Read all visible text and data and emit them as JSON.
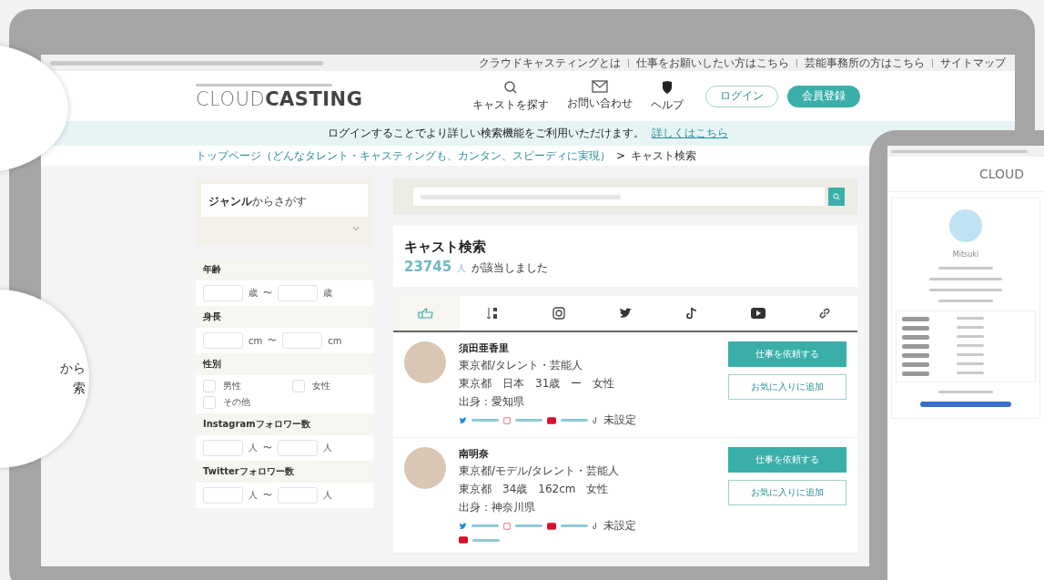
{
  "callout": {
    "lines": [
      "から",
      "索"
    ]
  },
  "laptop": {
    "top_bar": {
      "links": [
        "クラウドキャスティングとは",
        "仕事をお願いしたい方はこちら",
        "芸能事務所の方はこちら",
        "サイトマップ"
      ]
    },
    "header": {
      "logo_light": "CLOUD",
      "logo_bold": "CASTING",
      "nav": [
        {
          "kind": "search",
          "label": "キャストを探す"
        },
        {
          "kind": "mail",
          "label": "お問い合わせ"
        },
        {
          "kind": "help",
          "label": "ヘルプ"
        }
      ],
      "buttons": [
        {
          "kind": "outline",
          "label": "ログイン"
        },
        {
          "kind": "filled",
          "label": "会員登録"
        }
      ]
    },
    "notice": {
      "text": "ログインすることでより詳しい検索機能をご利用いただけます。",
      "link": "詳しくはこちら"
    },
    "breadcrumb": {
      "link": "トップページ（どんなタレント・キャスティングも、カンタン、スピーディに実現）",
      "separator": ">",
      "current": "キャスト検索"
    },
    "sidebar": {
      "genre": {
        "title": "ジャンル",
        "subtitle": "からさがす"
      },
      "filters": [
        {
          "kind": "range",
          "label": "年齢",
          "units": [
            "歳",
            "〜",
            "歳"
          ]
        },
        {
          "kind": "range",
          "label": "身長",
          "units": [
            "cm",
            "〜",
            "cm"
          ]
        },
        {
          "kind": "checks",
          "label": "性別",
          "options": [
            {
              "label": "男性",
              "checked": false
            },
            {
              "label": "女性",
              "checked": false
            },
            {
              "label": "その他",
              "checked": false
            }
          ]
        },
        {
          "kind": "range",
          "label": "Instagramフォロワー数",
          "units": [
            "人",
            "〜",
            "人"
          ]
        },
        {
          "kind": "range",
          "label": "Twitterフォロワー数",
          "units": [
            "人",
            "〜",
            "人"
          ]
        }
      ]
    },
    "main": {
      "title": "キャスト検索",
      "count": "23745",
      "count_unit": "人",
      "count_suffix": "が該当しました",
      "sort_tabs": [
        {
          "kind": "recommend",
          "selected": true
        },
        {
          "kind": "order",
          "selected": false
        },
        {
          "kind": "instagram",
          "selected": false
        },
        {
          "kind": "twitter",
          "selected": false
        },
        {
          "kind": "tiktok",
          "selected": false
        },
        {
          "kind": "youtube",
          "selected": false
        },
        {
          "kind": "link",
          "selected": false
        }
      ],
      "casts": [
        {
          "name": "須田亜香里",
          "category": "東京都/タレント・芸能人",
          "details": "東京都　日本　31歳　ー　女性",
          "origin": "出身：愛知県",
          "tiktok": "未設定",
          "extra_youtube": false,
          "buttons": [
            "仕事を依頼する",
            "お気に入りに追加"
          ]
        },
        {
          "name": "南明奈",
          "category": "東京都/モデル/タレント・芸能人",
          "details": "東京都　34歳　162cm　女性",
          "origin": "出身：神奈川県",
          "tiktok": "未設定",
          "extra_youtube": true,
          "buttons": [
            "仕事を依頼する",
            "お気に入りに追加"
          ]
        }
      ]
    }
  },
  "phone": {
    "logo": "CLOUD",
    "name": "Mitsuki"
  }
}
